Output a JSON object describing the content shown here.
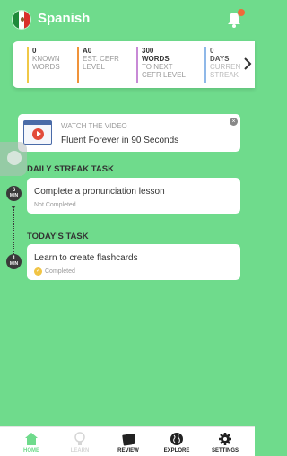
{
  "header": {
    "flag_icon": "mexico-flag-icon",
    "title": "Spanish",
    "notification_icon": "bell-icon",
    "notification_dot_color": "#f06a3a"
  },
  "stats": [
    {
      "value": "0",
      "label_line1": "KNOWN",
      "label_line2": "WORDS",
      "color": "#f0c847"
    },
    {
      "value": "A0",
      "label_line1": "Est. CEFR",
      "label_line2": "LEVEL",
      "color": "#f0933a"
    },
    {
      "value": "300",
      "value_line2": "WORDS",
      "label_line1": "TO NEXT",
      "label_line2": "CEFR LEVEL",
      "color": "#c88ad6"
    },
    {
      "value": "0",
      "value_line2": "DAYS",
      "label_line1": "CURREN",
      "label_line2": "STREAK",
      "color": "#8fb8e8"
    }
  ],
  "stats_more_icon": "chevron-right-icon",
  "video": {
    "kicker": "WATCH THE VIDEO",
    "title": "Fluent Forever in 90 Seconds",
    "close_glyph": "×"
  },
  "daily_streak": {
    "section_title": "DAILY STREAK TASK",
    "minutes": "6",
    "min_label": "MIN",
    "task_title": "Complete a pronunciation lesson",
    "status": "Not Completed"
  },
  "today": {
    "section_title": "TODAY'S TASK",
    "minutes": "1",
    "min_label": "MIN",
    "task_title": "Learn to create flashcards",
    "status": "Completed",
    "status_glyph": "✓"
  },
  "nav": {
    "home": "HOME",
    "learn": "LEARN",
    "review": "REVIEW",
    "explore": "EXPLORE",
    "settings": "SETTINGS"
  },
  "colors": {
    "background": "#6fdb8c",
    "accent": "#6fdb8c",
    "completed": "#f1c445"
  }
}
